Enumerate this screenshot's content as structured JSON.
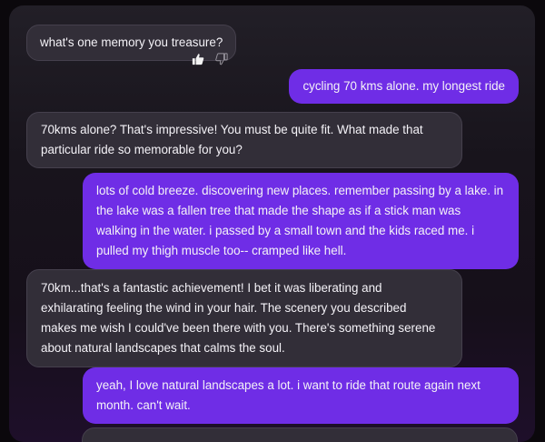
{
  "conversation": {
    "messages": [
      {
        "role": "bot",
        "text": "what's one memory you treasure?"
      },
      {
        "role": "user",
        "text": "cycling 70 kms alone. my longest ride"
      },
      {
        "role": "bot",
        "lines": [
          "70kms alone? That's impressive! You must be quite fit. What made that",
          "particular ride so memorable for you?"
        ]
      },
      {
        "role": "user",
        "lines": [
          "lots of cold breeze. discovering new places. remember passing by a lake. in",
          "the lake was a fallen tree that made the shape as if a stick man was",
          "walking in the water. i passed by a small town and the kids raced me. i",
          "pulled my thigh muscle too-- cramped like hell."
        ]
      },
      {
        "role": "bot",
        "lines": [
          "70km...that's a fantastic achievement! I bet it was liberating and",
          "exhilarating feeling the wind in your hair. The scenery you described",
          "makes me wish I could've been there with you. There's something serene",
          "about natural landscapes that calms the soul."
        ]
      },
      {
        "role": "user",
        "lines": [
          "yeah, I love natural landscapes a lot. i want to ride that route again next",
          "month. can't wait."
        ]
      }
    ],
    "feedback": {
      "thumbs_up_icon": "thumbs-up-icon",
      "thumbs_down_icon": "thumbs-down-icon"
    }
  },
  "colors": {
    "user_bubble": "#6f2de6",
    "bot_bubble": "#322e38",
    "text": "#f4f2f7",
    "page_background": "#0b080c"
  }
}
